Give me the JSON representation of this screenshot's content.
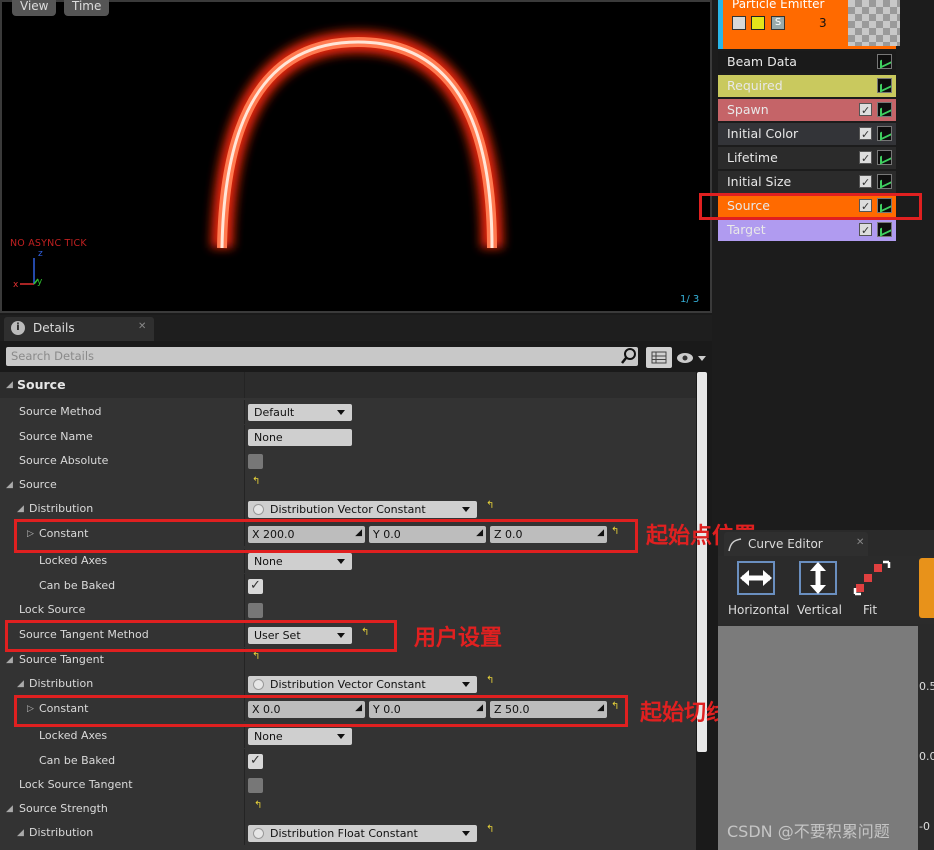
{
  "viewport": {
    "view_label": "View",
    "time_label": "Time",
    "async_text": "NO ASYNC TICK",
    "frame_text": "1/  3"
  },
  "emitter": {
    "title": "Particle Emitter",
    "count": "3",
    "solo_label": "S",
    "modules": [
      {
        "label": "Beam Data",
        "color": "#1a1a1a"
      },
      {
        "label": "Required",
        "color": "#c9c95e"
      },
      {
        "label": "Spawn",
        "color": "#c56468"
      },
      {
        "label": "Initial Color",
        "color": "#333438"
      },
      {
        "label": "Lifetime",
        "color": "#2b2b2b"
      },
      {
        "label": "Initial Size",
        "color": "#2b2b2b"
      },
      {
        "label": "Source",
        "color": "#ff6a00"
      },
      {
        "label": "Target",
        "color": "#b09bf0"
      }
    ]
  },
  "details": {
    "tab_label": "Details",
    "search_placeholder": "Search Details",
    "section_title": "Source",
    "rows": {
      "source_method": {
        "label": "Source Method",
        "value": "Default"
      },
      "source_name": {
        "label": "Source Name",
        "value": "None"
      },
      "source_absolute": {
        "label": "Source Absolute"
      },
      "source": {
        "label": "Source"
      },
      "distribution1": {
        "label": "Distribution",
        "value": "Distribution Vector Constant"
      },
      "constant1": {
        "label": "Constant",
        "x": "X  200.0",
        "y": "Y  0.0",
        "z": "Z  0.0"
      },
      "locked_axes1": {
        "label": "Locked Axes",
        "value": "None"
      },
      "can_be_baked1": {
        "label": "Can be Baked"
      },
      "lock_source": {
        "label": "Lock Source"
      },
      "source_tangent_method": {
        "label": "Source Tangent Method",
        "value": "User Set"
      },
      "source_tangent": {
        "label": "Source Tangent"
      },
      "distribution2": {
        "label": "Distribution",
        "value": "Distribution Vector Constant"
      },
      "constant2": {
        "label": "Constant",
        "x": "X  0.0",
        "y": "Y  0.0",
        "z": "Z  50.0"
      },
      "locked_axes2": {
        "label": "Locked Axes",
        "value": "None"
      },
      "can_be_baked2": {
        "label": "Can be Baked"
      },
      "lock_source_tangent": {
        "label": "Lock Source Tangent"
      },
      "source_strength": {
        "label": "Source Strength"
      },
      "distribution3": {
        "label": "Distribution",
        "value": "Distribution Float Constant"
      }
    }
  },
  "annotations": {
    "start_position": "起始点位置",
    "user_set": "用户设置",
    "start_tangent": "起始切线角度"
  },
  "curve_editor": {
    "tab_label": "Curve Editor",
    "horizontal": "Horizontal",
    "vertical": "Vertical",
    "fit": "Fit",
    "axis_05": "0.5",
    "axis_00": "0.0",
    "axis_neg": "-0"
  },
  "watermark": "CSDN @不要积累问题"
}
